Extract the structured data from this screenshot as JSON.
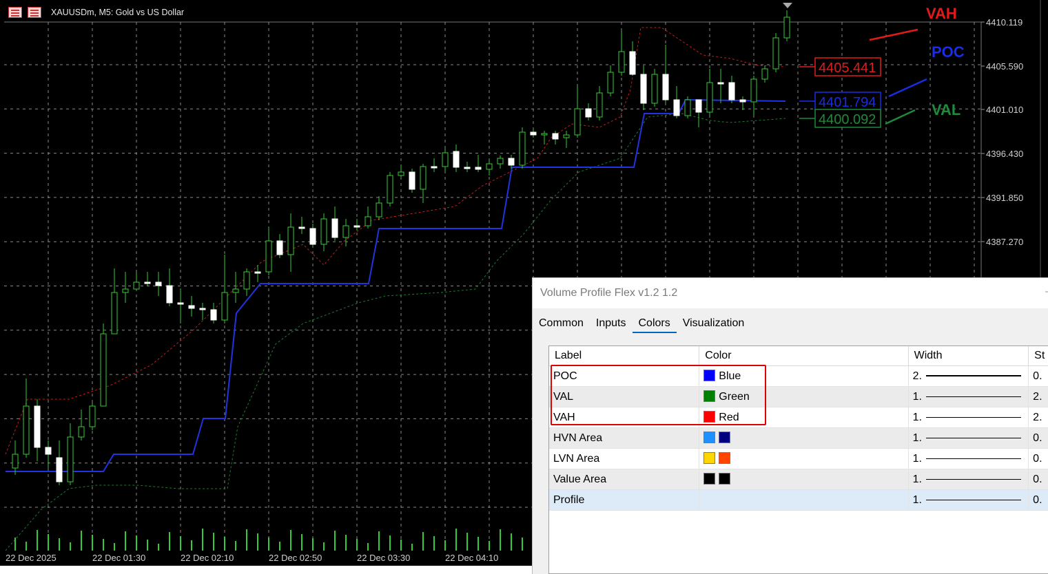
{
  "chart": {
    "title": "XAUUSDm, M5:  Gold vs US Dollar",
    "price_axis": [
      "4410.119",
      "4405.590",
      "4401.010",
      "4396.430",
      "4391.850",
      "4387.270"
    ],
    "time_axis": [
      "22 Dec 2025",
      "22 Dec 01:30",
      "22 Dec 02:10",
      "22 Dec 02:50",
      "22 Dec 03:30",
      "22 Dec 04:10"
    ],
    "level_boxes": {
      "vah": "4405.441",
      "poc": "4401.794",
      "val": "4400.092"
    },
    "right_labels": {
      "vah": "VAH",
      "poc": "POC",
      "val": "VAL"
    },
    "colors": {
      "vah": "#e11b1b",
      "poc": "#1a2ce6",
      "val": "#1f8a3a",
      "candle_up": "#33cc33",
      "candle_down": "#ffffff",
      "grid": "#8a8a8a"
    },
    "icons": [
      "chart-window-icon",
      "chart-restore-icon"
    ]
  },
  "dialog": {
    "title": "Volume Profile Flex v1.2 1.2",
    "minimize_glyph": "–",
    "tabs": [
      "Common",
      "Inputs",
      "Colors",
      "Visualization"
    ],
    "active_tab": "Colors",
    "columns": [
      "Label",
      "Color",
      "Width",
      "St"
    ],
    "rows": [
      {
        "label": "POC",
        "color_name": "Blue",
        "swatches": [
          "#0000ff"
        ],
        "width": "2.",
        "style": "0."
      },
      {
        "label": "VAL",
        "color_name": "Green",
        "swatches": [
          "#008000"
        ],
        "width": "1.",
        "style": "2."
      },
      {
        "label": "VAH",
        "color_name": "Red",
        "swatches": [
          "#ff0000"
        ],
        "width": "1.",
        "style": "2."
      },
      {
        "label": "HVN Area",
        "color_name": "",
        "swatches": [
          "#1e90ff",
          "#000080"
        ],
        "width": "1.",
        "style": "0."
      },
      {
        "label": "LVN Area",
        "color_name": "",
        "swatches": [
          "#ffd700",
          "#ff4500"
        ],
        "width": "1.",
        "style": "0."
      },
      {
        "label": "Value Area",
        "color_name": "",
        "swatches": [
          "#000000",
          "#000000"
        ],
        "width": "1.",
        "style": "0."
      },
      {
        "label": "Profile",
        "color_name": "",
        "swatches": [],
        "width": "1.",
        "style": "0."
      }
    ]
  }
}
